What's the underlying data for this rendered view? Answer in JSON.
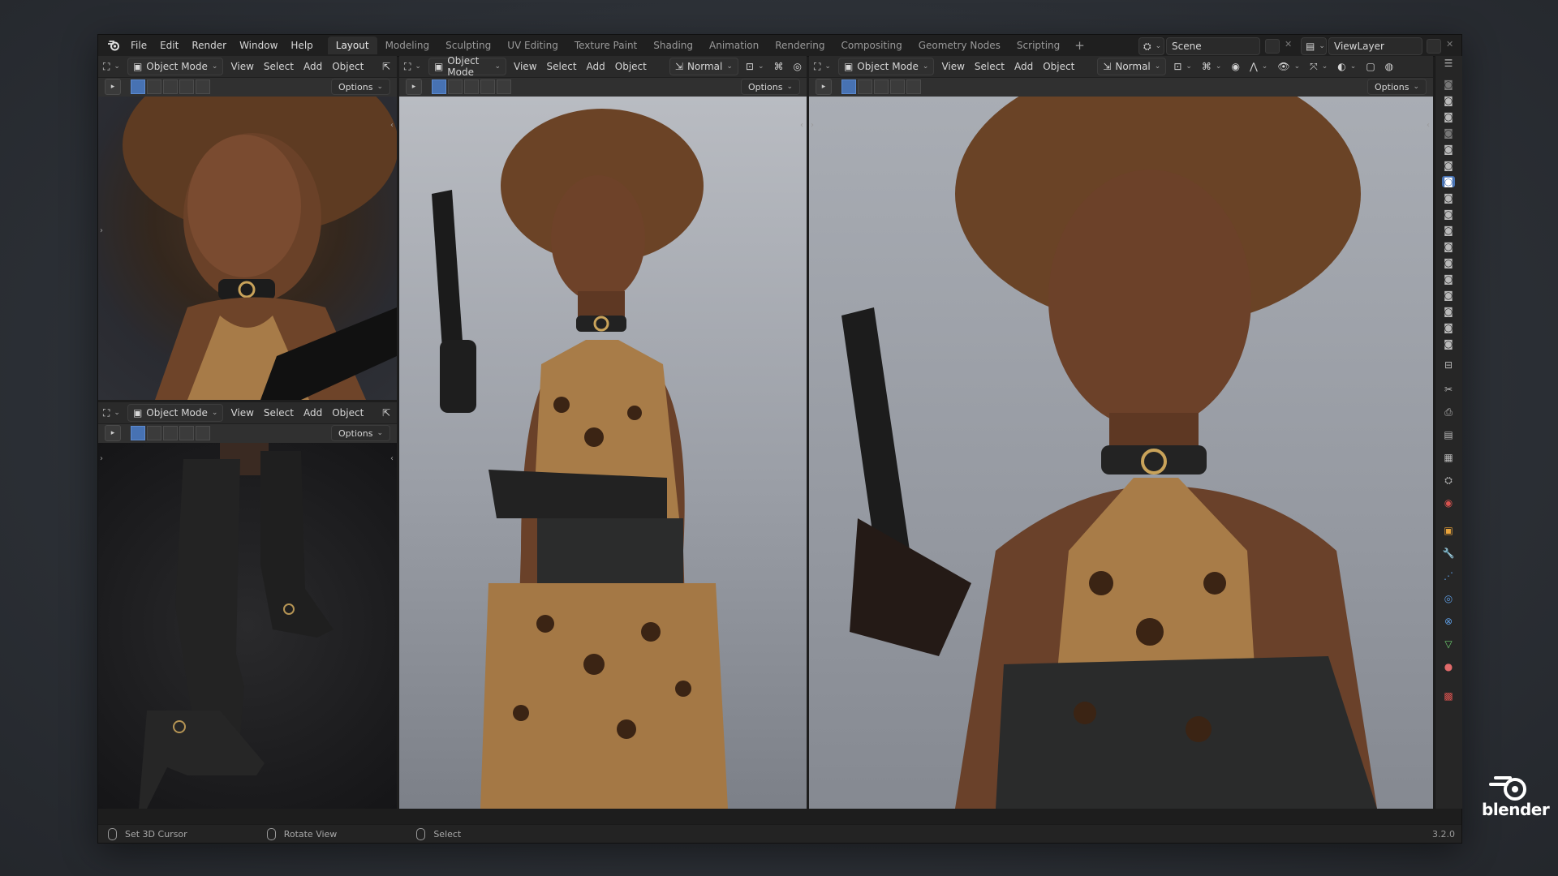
{
  "menubar": [
    "File",
    "Edit",
    "Render",
    "Window",
    "Help"
  ],
  "workspaces": [
    {
      "label": "Layout",
      "active": true
    },
    {
      "label": "Modeling"
    },
    {
      "label": "Sculpting"
    },
    {
      "label": "UV Editing"
    },
    {
      "label": "Texture Paint"
    },
    {
      "label": "Shading"
    },
    {
      "label": "Animation"
    },
    {
      "label": "Rendering"
    },
    {
      "label": "Compositing"
    },
    {
      "label": "Geometry Nodes"
    },
    {
      "label": "Scripting"
    }
  ],
  "add_workspace": "+",
  "scene": "Scene",
  "view_layer": "ViewLayer",
  "viewport": {
    "mode": "Object Mode",
    "menu": [
      "View",
      "Select",
      "Add",
      "Object"
    ],
    "orientation": "Normal",
    "options": "Options"
  },
  "status": {
    "left": "Set 3D Cursor",
    "middle": "Rotate View",
    "right": "Select",
    "version": "3.2.0"
  },
  "brand": "blender",
  "colors": {
    "accent": "#4772b3",
    "header": "#2a2a2a",
    "panel": "#303030"
  }
}
